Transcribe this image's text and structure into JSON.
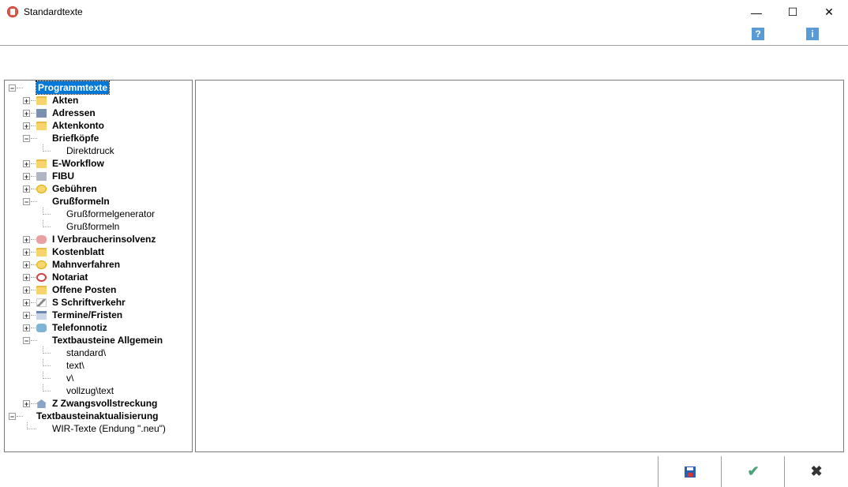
{
  "window": {
    "title": "Standardtexte"
  },
  "toolbar": {
    "help_icon": "?",
    "info_icon": "i"
  },
  "tree": [
    {
      "label": "Programmtexte",
      "level": 0,
      "expander": "minus",
      "bold": true,
      "selected": true,
      "icon": "none"
    },
    {
      "label": "Akten",
      "level": 1,
      "expander": "plus",
      "bold": true,
      "icon": "folder"
    },
    {
      "label": "Adressen",
      "level": 1,
      "expander": "plus",
      "bold": true,
      "icon": "blue"
    },
    {
      "label": "Aktenkonto",
      "level": 1,
      "expander": "plus",
      "bold": true,
      "icon": "folder"
    },
    {
      "label": "Briefköpfe",
      "level": 1,
      "expander": "minus",
      "bold": true,
      "icon": "none"
    },
    {
      "label": "Direktdruck",
      "level": 2,
      "expander": "none",
      "bold": false,
      "icon": "none"
    },
    {
      "label": "E-Workflow",
      "level": 1,
      "expander": "plus",
      "bold": true,
      "icon": "folder"
    },
    {
      "label": "FIBU",
      "level": 1,
      "expander": "plus",
      "bold": true,
      "icon": "grey"
    },
    {
      "label": "Gebühren",
      "level": 1,
      "expander": "plus",
      "bold": true,
      "icon": "round"
    },
    {
      "label": "Grußformeln",
      "level": 1,
      "expander": "minus",
      "bold": true,
      "icon": "none"
    },
    {
      "label": "Grußformelgenerator",
      "level": 2,
      "expander": "none",
      "bold": false,
      "icon": "none"
    },
    {
      "label": "Grußformeln",
      "level": 2,
      "expander": "none",
      "bold": false,
      "icon": "none"
    },
    {
      "label": "I Verbraucherinsolvenz",
      "level": 1,
      "expander": "plus",
      "bold": true,
      "icon": "pink"
    },
    {
      "label": "Kostenblatt",
      "level": 1,
      "expander": "plus",
      "bold": true,
      "icon": "folder"
    },
    {
      "label": "Mahnverfahren",
      "level": 1,
      "expander": "plus",
      "bold": true,
      "icon": "round"
    },
    {
      "label": "Notariat",
      "level": 1,
      "expander": "plus",
      "bold": true,
      "icon": "red"
    },
    {
      "label": "Offene Posten",
      "level": 1,
      "expander": "plus",
      "bold": true,
      "icon": "folder"
    },
    {
      "label": "S Schriftverkehr",
      "level": 1,
      "expander": "plus",
      "bold": true,
      "icon": "pen"
    },
    {
      "label": "Termine/Fristen",
      "level": 1,
      "expander": "plus",
      "bold": true,
      "icon": "cal"
    },
    {
      "label": "Telefonnotiz",
      "level": 1,
      "expander": "plus",
      "bold": true,
      "icon": "phone"
    },
    {
      "label": "Textbausteine Allgemein",
      "level": 1,
      "expander": "minus",
      "bold": true,
      "icon": "none"
    },
    {
      "label": "standard\\",
      "level": 2,
      "expander": "none",
      "bold": false,
      "icon": "none"
    },
    {
      "label": "text\\",
      "level": 2,
      "expander": "none",
      "bold": false,
      "icon": "none"
    },
    {
      "label": "v\\",
      "level": 2,
      "expander": "none",
      "bold": false,
      "icon": "none"
    },
    {
      "label": "vollzug\\text",
      "level": 2,
      "expander": "none",
      "bold": false,
      "icon": "none"
    },
    {
      "label": "Z Zwangsvollstreckung",
      "level": 1,
      "expander": "plus",
      "bold": true,
      "icon": "house"
    },
    {
      "label": "Textbausteinaktualisierung",
      "level": 0,
      "expander": "minus",
      "bold": true,
      "icon": "none"
    },
    {
      "label": "WIR-Texte (Endung \".neu\")",
      "level": 1,
      "expander": "none",
      "bold": false,
      "icon": "none"
    }
  ]
}
